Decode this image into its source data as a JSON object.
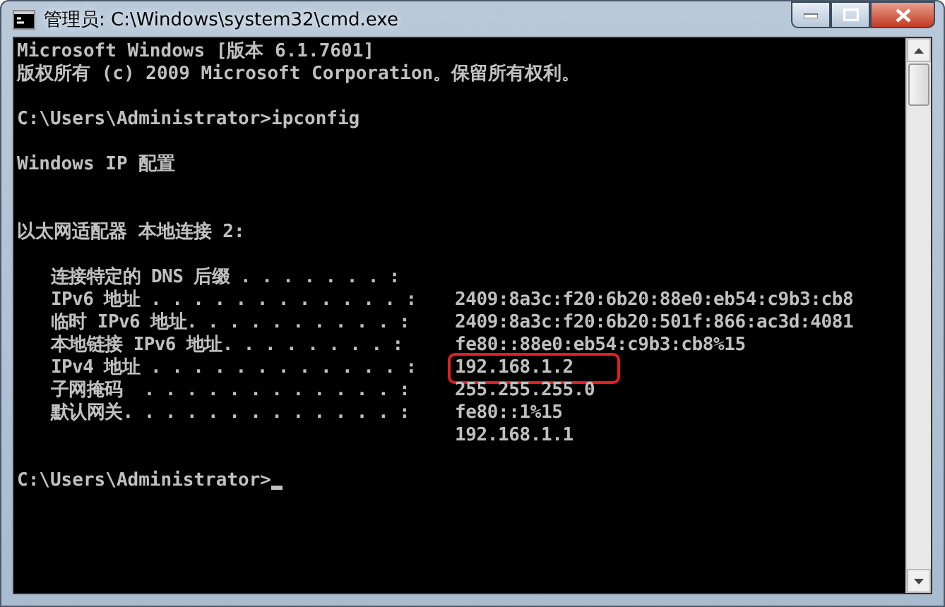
{
  "window": {
    "title": "管理员: C:\\Windows\\system32\\cmd.exe"
  },
  "console": {
    "lines": [
      {
        "kind": "text",
        "text": "Microsoft Windows [版本 6.1.7601]"
      },
      {
        "kind": "text",
        "text": "版权所有 (c) 2009 Microsoft Corporation。保留所有权利。"
      },
      {
        "kind": "blank"
      },
      {
        "kind": "text",
        "text": "C:\\Users\\Administrator>ipconfig"
      },
      {
        "kind": "blank"
      },
      {
        "kind": "text",
        "text": "Windows IP 配置"
      },
      {
        "kind": "blank"
      },
      {
        "kind": "blank"
      },
      {
        "kind": "text",
        "text": "以太网适配器 本地连接 2:"
      },
      {
        "kind": "blank"
      },
      {
        "kind": "entry",
        "label": "连接特定的 DNS 后缀 . . . . . . . :"
      },
      {
        "kind": "entry",
        "label": "IPv6 地址 . . . . . . . . . . . . :",
        "value": "2409:8a3c:f20:6b20:88e0:eb54:c9b3:cb8"
      },
      {
        "kind": "entry",
        "label": "临时 IPv6 地址. . . . . . . . . . :",
        "value": "2409:8a3c:f20:6b20:501f:866:ac3d:4081"
      },
      {
        "kind": "entry",
        "label": "本地链接 IPv6 地址. . . . . . . . :",
        "value": "fe80::88e0:eb54:c9b3:cb8%15"
      },
      {
        "kind": "entry",
        "label": "IPv4 地址 . . . . . . . . . . . . :",
        "value": "192.168.1.2",
        "highlighted": true
      },
      {
        "kind": "entry",
        "label": "子网掩码  . . . . . . . . . . . . :",
        "value": "255.255.255.0"
      },
      {
        "kind": "entry",
        "label": "默认网关. . . . . . . . . . . . . :",
        "value": "fe80::1%15"
      },
      {
        "kind": "entry",
        "value": "192.168.1.1"
      },
      {
        "kind": "blank"
      },
      {
        "kind": "prompt",
        "text": "C:\\Users\\Administrator>",
        "cursor": true
      }
    ]
  }
}
